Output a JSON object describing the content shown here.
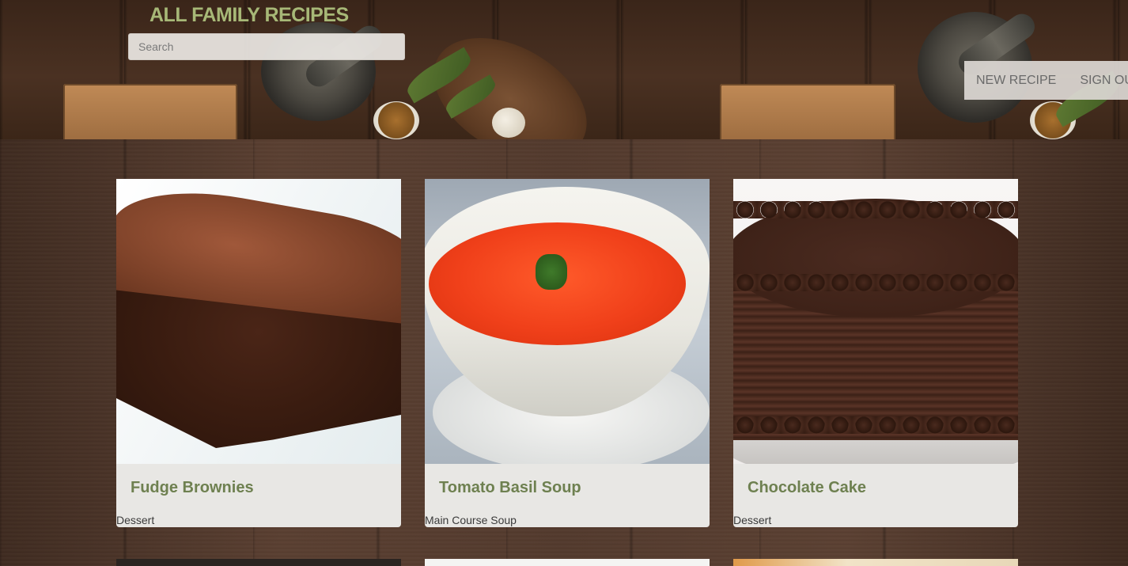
{
  "header": {
    "site_title": "ALL FAMILY RECIPES",
    "search_placeholder": "Search",
    "nav": [
      {
        "label": "NEW RECIPE"
      },
      {
        "label": "SIGN OUT"
      }
    ]
  },
  "recipes": [
    {
      "title": "Fudge Brownies",
      "category": "Dessert",
      "image": "fudge-brownies-photo"
    },
    {
      "title": "Tomato Basil Soup",
      "category": "Main Course Soup",
      "image": "tomato-soup-photo"
    },
    {
      "title": "Chocolate Cake",
      "category": "Dessert",
      "image": "chocolate-cake-photo"
    }
  ],
  "colors": {
    "title_green": "#a7b877",
    "card_title_green": "#6e8050",
    "card_bg": "#e8e7e4",
    "nav_text": "#6a6a6a"
  }
}
